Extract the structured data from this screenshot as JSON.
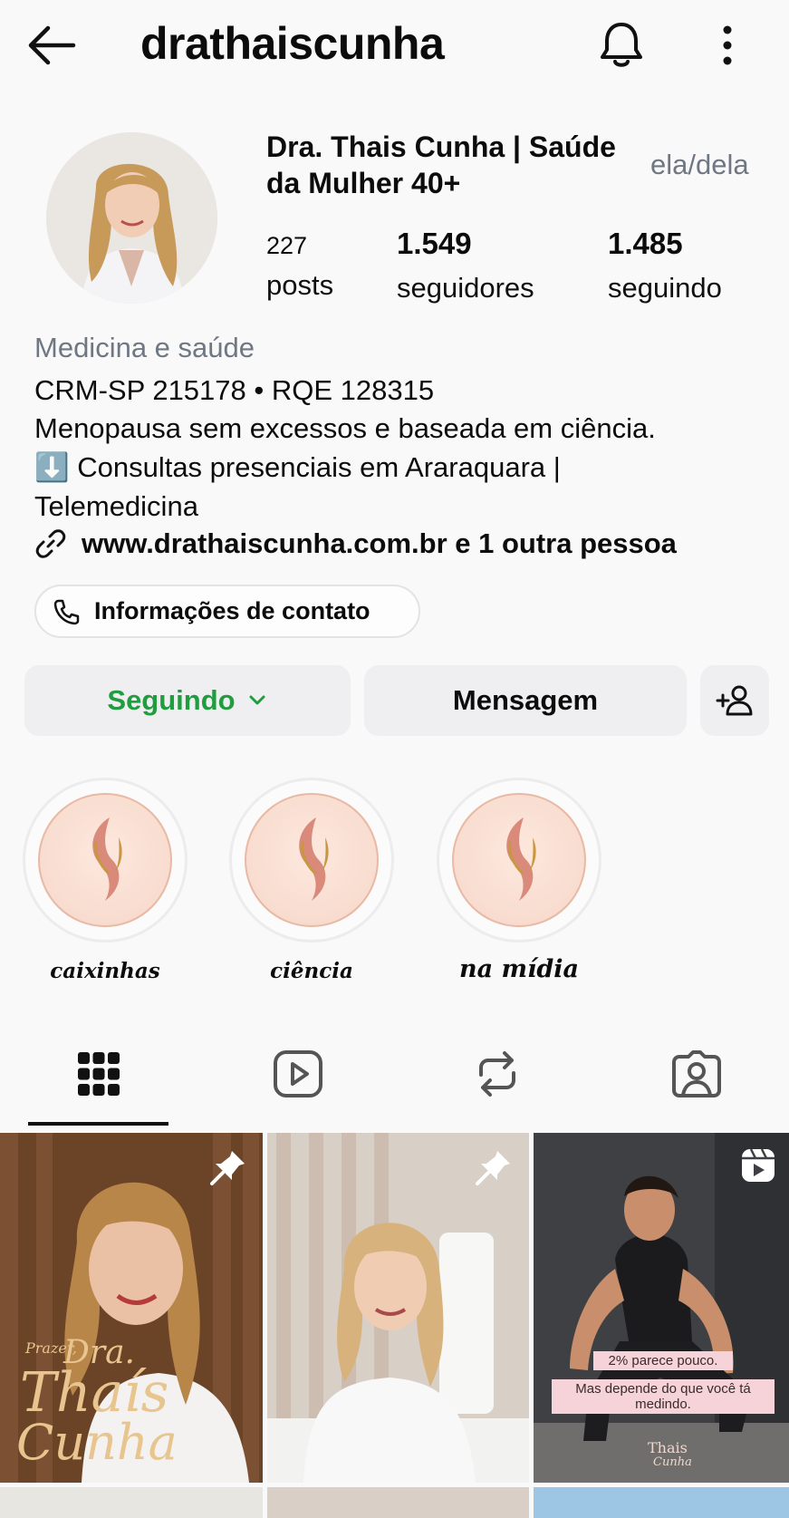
{
  "header": {
    "username": "drathaiscunha",
    "back_icon": "arrow-left-icon",
    "bell_icon": "bell-icon",
    "more_icon": "more-vertical-icon"
  },
  "profile": {
    "display_name": "Dra. Thais Cunha | Saúde da Mulher 40+",
    "pronouns": "ela/dela",
    "stats": [
      {
        "value": "227",
        "label": "posts"
      },
      {
        "value": "1.549",
        "label": "seguidores"
      },
      {
        "value": "1.485",
        "label": "seguindo"
      }
    ]
  },
  "bio": {
    "category": "Medicina e saúde",
    "lines": [
      "CRM-SP 215178 • RQE 128315",
      "Menopausa sem excessos e baseada em ciência.",
      "⬇️ Consultas presenciais em Araraquara |",
      "Telemedicina"
    ],
    "link": "www.drathaiscunha.com.br e 1 outra pessoa"
  },
  "buttons": {
    "contact": "Informações de contato",
    "following": "Seguindo",
    "message": "Mensagem"
  },
  "highlights": [
    {
      "label": "caixinhas"
    },
    {
      "label": "ciência"
    },
    {
      "label": "na mídia"
    }
  ],
  "tabs": [
    "grid-icon",
    "reels-icon",
    "reposts-icon",
    "tagged-icon"
  ],
  "grid": {
    "tile1_text": [
      "Prazer,",
      "Dra.",
      "Thaís",
      "Cunha"
    ],
    "tile3_captions": [
      "2% parece pouco.",
      "Mas depende do que você tá medindo."
    ],
    "tile3_logo": [
      "Thais",
      "Cunha"
    ]
  },
  "colors": {
    "following_green": "#1f9d3f",
    "background": "#f9f9fa",
    "button_gray": "#efeff1"
  }
}
